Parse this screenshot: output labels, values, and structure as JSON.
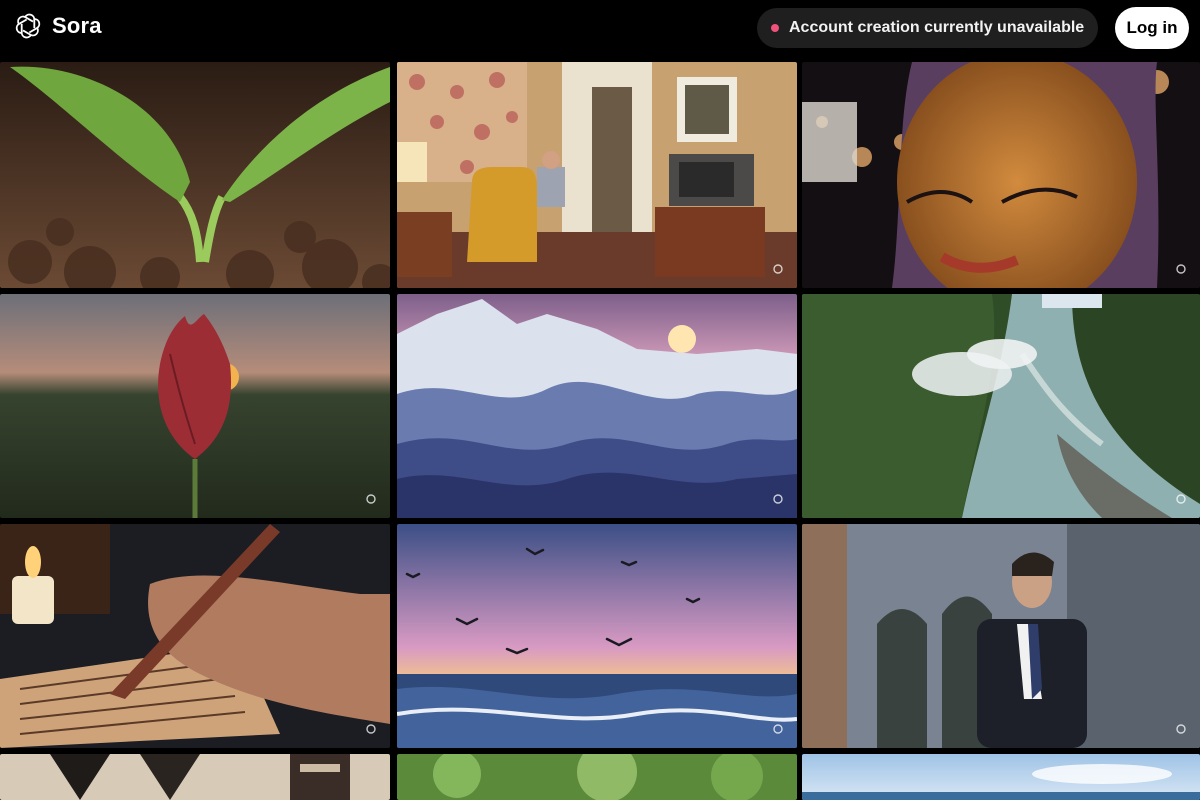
{
  "app": {
    "name": "Sora"
  },
  "header": {
    "notice": "Account creation currently unavailable",
    "login_label": "Log in"
  },
  "colors": {
    "background": "#000000",
    "notice_bg": "#1f1f1f",
    "notice_dot": "#f0527c",
    "button_bg": "#ffffff"
  },
  "icons": {
    "logo": "openai-logo-icon",
    "watermark": "openai-watermark-icon",
    "status": "status-dot-icon"
  }
}
